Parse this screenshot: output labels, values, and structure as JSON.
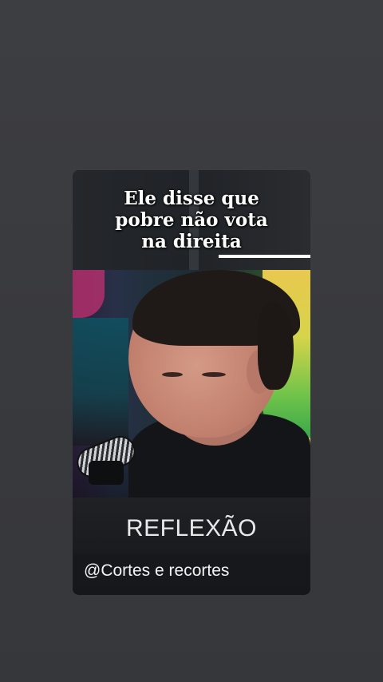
{
  "caption": {
    "lines": [
      "Ele disse que",
      "pobre não vota",
      "na direita"
    ]
  },
  "overlay": {
    "title": "REFLEXÃO",
    "handle": "@Cortes e recortes"
  },
  "colors": {
    "background": "#3a3b3f",
    "caption_text": "#ffffff",
    "title_text": "#e9e9ea"
  }
}
